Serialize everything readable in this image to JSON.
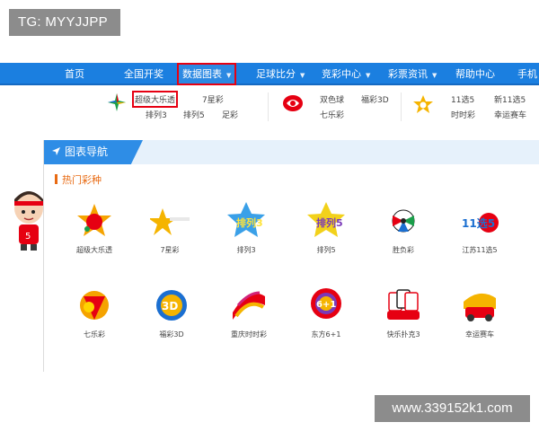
{
  "watermarks": {
    "top_left": "TG: MYYJJPP",
    "bottom_right": "www.339152k1.com"
  },
  "topnav": {
    "items": [
      {
        "label": "首页"
      },
      {
        "label": "全国开奖"
      },
      {
        "label": "数据图表",
        "active": true
      },
      {
        "label": "足球比分"
      },
      {
        "label": "竞彩中心"
      },
      {
        "label": "彩票资讯"
      },
      {
        "label": "帮助中心"
      },
      {
        "label": "手机"
      }
    ],
    "colors": {
      "bar": "#1b7fe0",
      "highlight": "#e60012"
    }
  },
  "subnav": {
    "group1": [
      "超级大乐透",
      "7星彩",
      "排列3",
      "排列5",
      "足彩"
    ],
    "group2": [
      "双色球",
      "福彩3D",
      "七乐彩"
    ],
    "group3": [
      "11选5",
      "新11选5",
      "时时彩",
      "幸运赛车"
    ]
  },
  "panel": {
    "title": "图表导航",
    "section": "热门彩种",
    "games_row1": [
      "超级大乐透",
      "7星彩",
      "排列3",
      "排列5",
      "胜负彩",
      "江苏11选5"
    ],
    "games_row2": [
      "七乐彩",
      "福彩3D",
      "重庆时时彩",
      "东方6+1",
      "快乐扑克3",
      "幸运赛车"
    ],
    "icon_texts": {
      "pl3": "排列3",
      "pl5": "排列5",
      "js115": "11选5",
      "fc3d": "3D",
      "df61": "6+1"
    },
    "colors": {
      "tab": "#2e8de6",
      "header": "#e6f1fb",
      "section": "#e86a12"
    }
  }
}
